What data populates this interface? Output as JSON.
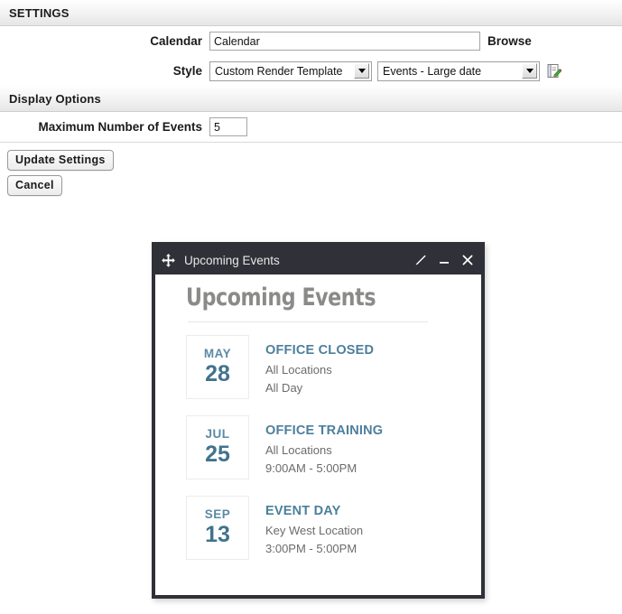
{
  "settings": {
    "band_title": "SETTINGS",
    "calendar": {
      "label": "Calendar",
      "value": "Calendar",
      "placeholder": "Calendar",
      "browse_label": "Browse"
    },
    "style": {
      "label": "Style",
      "select_one_value": "Custom Render Template",
      "select_two_value": "Events - Large date",
      "edit_icon": "edit-template-icon"
    }
  },
  "display_options": {
    "band_title": "Display Options",
    "max_events": {
      "label": "Maximum Number of Events",
      "value": "5"
    }
  },
  "actions": {
    "update_label": "Update Settings",
    "cancel_label": "Cancel"
  },
  "widget": {
    "titlebar": {
      "move_icon": "move-arrows-icon",
      "title": "Upcoming Events",
      "edit_icon": "pencil-icon",
      "minimize_icon": "minimize-icon",
      "close_icon": "close-icon"
    },
    "heading": "Upcoming Events",
    "events": [
      {
        "month": "MAY",
        "day": "28",
        "title": "OFFICE CLOSED",
        "location": "All Locations",
        "time": "All Day"
      },
      {
        "month": "JUL",
        "day": "25",
        "title": "OFFICE TRAINING",
        "location": "All Locations",
        "time": "9:00AM - 5:00PM"
      },
      {
        "month": "SEP",
        "day": "13",
        "title": "EVENT DAY",
        "location": "Key West Location",
        "time": "3:00PM - 5:00PM"
      }
    ]
  },
  "colors": {
    "titlebar_bg": "#2f3038",
    "event_accent": "#4c7f9c",
    "heading_gray": "#8a8a88"
  }
}
